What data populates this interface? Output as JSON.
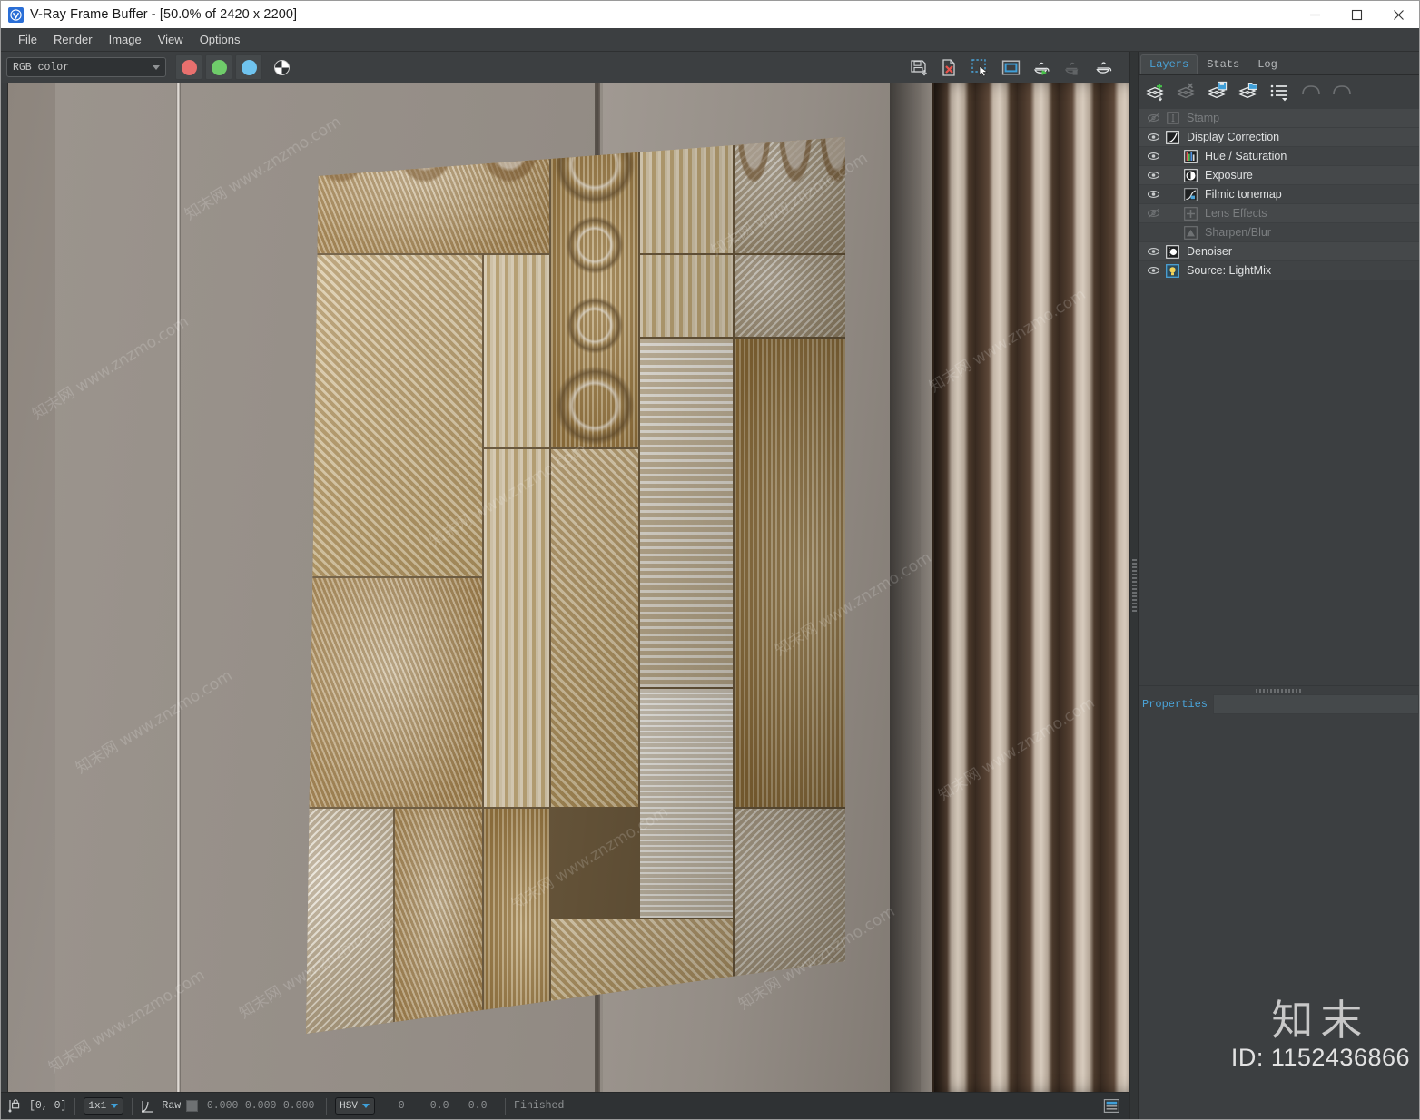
{
  "window": {
    "title": "V-Ray Frame Buffer - [50.0% of 2420 x 2200]",
    "app_icon": "vray-logo-icon",
    "minimize": "minimize-icon",
    "maximize": "maximize-icon",
    "close": "close-icon"
  },
  "menubar": {
    "items": [
      {
        "label": "File"
      },
      {
        "label": "Render"
      },
      {
        "label": "Image"
      },
      {
        "label": "View"
      },
      {
        "label": "Options"
      }
    ]
  },
  "toolbar": {
    "channel_select": {
      "value": "RGB color",
      "icon": "chevron-down-icon"
    },
    "channels": [
      {
        "name": "red-channel-button",
        "color": "#e8706e"
      },
      {
        "name": "green-channel-button",
        "color": "#6fcc6a"
      },
      {
        "name": "blue-channel-button",
        "color": "#6fc3ee"
      }
    ],
    "alpha_button": "alpha-channel-icon",
    "right_buttons": [
      {
        "name": "save-image-button",
        "icon": "save-icon",
        "enabled": "true"
      },
      {
        "name": "clear-image-button",
        "icon": "clear-image-icon",
        "enabled": "true"
      },
      {
        "name": "region-render-button",
        "icon": "region-select-icon",
        "enabled": "true"
      },
      {
        "name": "follow-mouse-button",
        "icon": "viewport-frame-icon",
        "enabled": "true"
      },
      {
        "name": "start-render-button",
        "icon": "teapot-play-icon",
        "enabled": "true"
      },
      {
        "name": "stop-render-button",
        "icon": "teapot-stop-icon",
        "enabled": "false"
      },
      {
        "name": "render-last-button",
        "icon": "teapot-icon",
        "enabled": "true"
      }
    ]
  },
  "statusbar": {
    "pixel_lock_icon": "pixel-lock-icon",
    "coordinates": "[0,  0]",
    "zoom_level": {
      "value": "1x1",
      "icon": "chevron-down-icon"
    },
    "curve_icon": "curve-icon",
    "raw_label": "Raw",
    "raw_values": [
      "0.000",
      "0.000",
      "0.000"
    ],
    "color_mode": {
      "value": "HSV",
      "icon": "chevron-down-icon"
    },
    "hsv_values": [
      "0",
      "0.0",
      "0.0"
    ],
    "render_status": "Finished",
    "panel_toggle_icon": "panel-toggle-icon"
  },
  "right_panel": {
    "tabs": [
      {
        "label": "Layers",
        "active": true
      },
      {
        "label": "Stats",
        "active": false
      },
      {
        "label": "Log",
        "active": false
      }
    ],
    "layer_toolbar": [
      {
        "name": "add-layer-button",
        "icon": "layer-add-icon",
        "enabled": "true"
      },
      {
        "name": "delete-layer-button",
        "icon": "layer-delete-icon",
        "enabled": "false"
      },
      {
        "name": "save-layers-button",
        "icon": "layer-save-icon",
        "enabled": "true"
      },
      {
        "name": "load-layers-button",
        "icon": "layer-load-icon",
        "enabled": "true"
      },
      {
        "name": "layer-presets-button",
        "icon": "layer-list-icon",
        "enabled": "true"
      },
      {
        "name": "undo-button",
        "icon": "undo-icon",
        "enabled": "false"
      },
      {
        "name": "redo-button",
        "icon": "redo-icon",
        "enabled": "false"
      }
    ],
    "layers": [
      {
        "label": "Stamp",
        "icon": "stamp-icon",
        "visible": false,
        "indent": 0
      },
      {
        "label": "Display Correction",
        "icon": "curve-icon",
        "visible": true,
        "indent": 0
      },
      {
        "label": "Hue / Saturation",
        "icon": "hue-saturation-icon",
        "visible": true,
        "indent": 1
      },
      {
        "label": "Exposure",
        "icon": "exposure-icon",
        "visible": true,
        "indent": 1
      },
      {
        "label": "Filmic tonemap",
        "icon": "filmic-tonemap-icon",
        "visible": true,
        "indent": 1
      },
      {
        "label": "Lens Effects",
        "icon": "lens-effects-icon",
        "visible": false,
        "indent": 1
      },
      {
        "label": "Sharpen/Blur",
        "icon": "sharpen-blur-icon",
        "visible": false,
        "indent": 1
      },
      {
        "label": "Denoiser",
        "icon": "denoiser-icon",
        "visible": true,
        "indent": 0
      },
      {
        "label": "Source: LightMix",
        "icon": "lightmix-icon",
        "visible": true,
        "indent": 0
      }
    ],
    "properties": {
      "title": "Properties"
    }
  },
  "watermark": {
    "site_marks": [
      "知末网 www.znzmo.com",
      "知末网 www.znzmo.com",
      "知末网 www.znzmo.com",
      "知末网 www.znzmo.com",
      "知末网 www.znzmo.com",
      "知末网 www.znzmo.com",
      "知末网 www.znzmo.com",
      "知末网 www.znzmo.com",
      "知末网 www.znzmo.com",
      "知末网 www.znzmo.com",
      "知末网 www.znzmo.com",
      "知末网 www.znzmo.com"
    ],
    "brand": "知末",
    "id": "ID: 1152436866"
  },
  "render_scene": {
    "description": "Interior wall render: carved whitewashed wood panel artwork mounted on a beige plaster wall with dark wood vertical slat paneling on the right."
  },
  "colors": {
    "accent": "#4aa3d8",
    "panel_bg": "#3c3f41",
    "row_bg": "#45484a",
    "canvas_bg": "#2b2b2b",
    "text": "#dfe1e2",
    "text_dim": "#7b7e80"
  }
}
